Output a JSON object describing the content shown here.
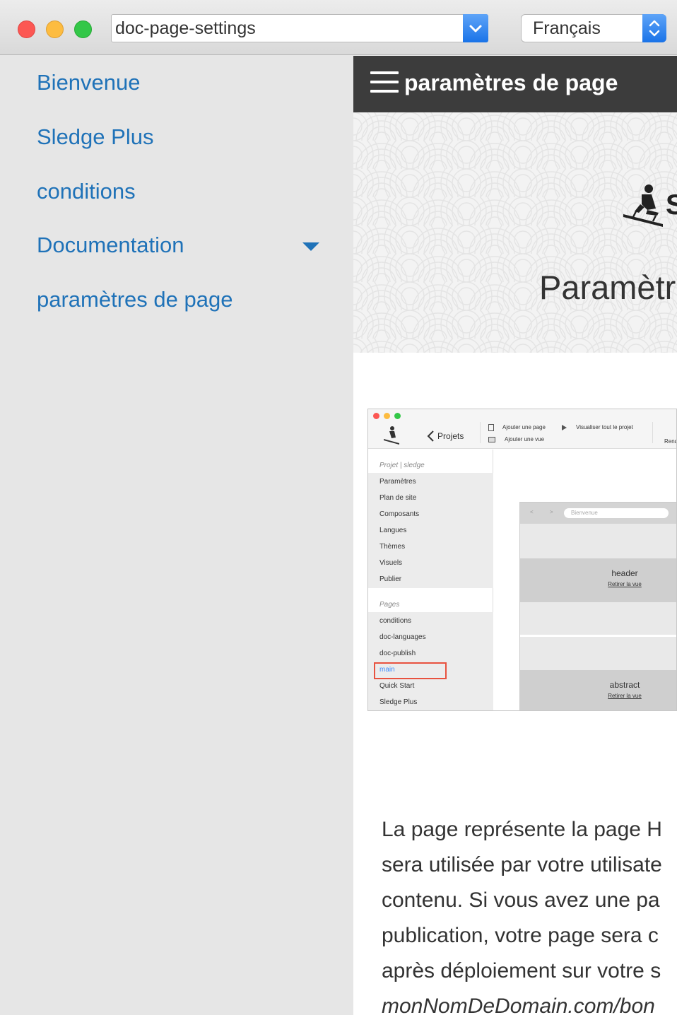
{
  "window": {
    "page_select_value": "doc-page-settings",
    "language_select_value": "Français"
  },
  "sidebar": {
    "items": [
      {
        "label": "Bienvenue"
      },
      {
        "label": "Sledge Plus"
      },
      {
        "label": "conditions"
      },
      {
        "label": "Documentation"
      },
      {
        "label": "paramètres de page"
      }
    ]
  },
  "header": {
    "title": "paramètres de page"
  },
  "hero": {
    "title": "Paramètr",
    "logo_letter": "S"
  },
  "screenshot": {
    "back_label": "Projets",
    "add_page": "Ajouter une page",
    "add_view": "Ajouter une vue",
    "view_all": "Visualiser tout le projet",
    "render_cut": "Rend",
    "project_heading": "Projet | sledge",
    "project_items": [
      "Paramètres",
      "Plan de site",
      "Composants",
      "Langues",
      "Thèmes",
      "Visuels",
      "Publier"
    ],
    "pages_heading": "Pages",
    "pages_items": [
      "conditions",
      "doc-languages",
      "doc-publish",
      "main",
      "Quick Start",
      "Sledge Plus"
    ],
    "mock_url": "Bienvenue",
    "band1_label": "header",
    "band1_link": "Retirer la vue",
    "band2_label": "abstract",
    "band2_link": "Retirer la vue",
    "highlight_color": "#e8523f"
  },
  "paragraph": {
    "lines": [
      "La page représente la page H",
      "sera utilisée par votre utilisate",
      "contenu. Si vous avez une pa",
      "publication, votre page sera c",
      "après déploiement sur votre s"
    ],
    "italic_line": "monNomDeDomain.com/bon"
  },
  "colors": {
    "link_blue": "#1f72b8",
    "topbar": "#3c3c3c",
    "sidebar_bg": "#e6e6e6"
  }
}
